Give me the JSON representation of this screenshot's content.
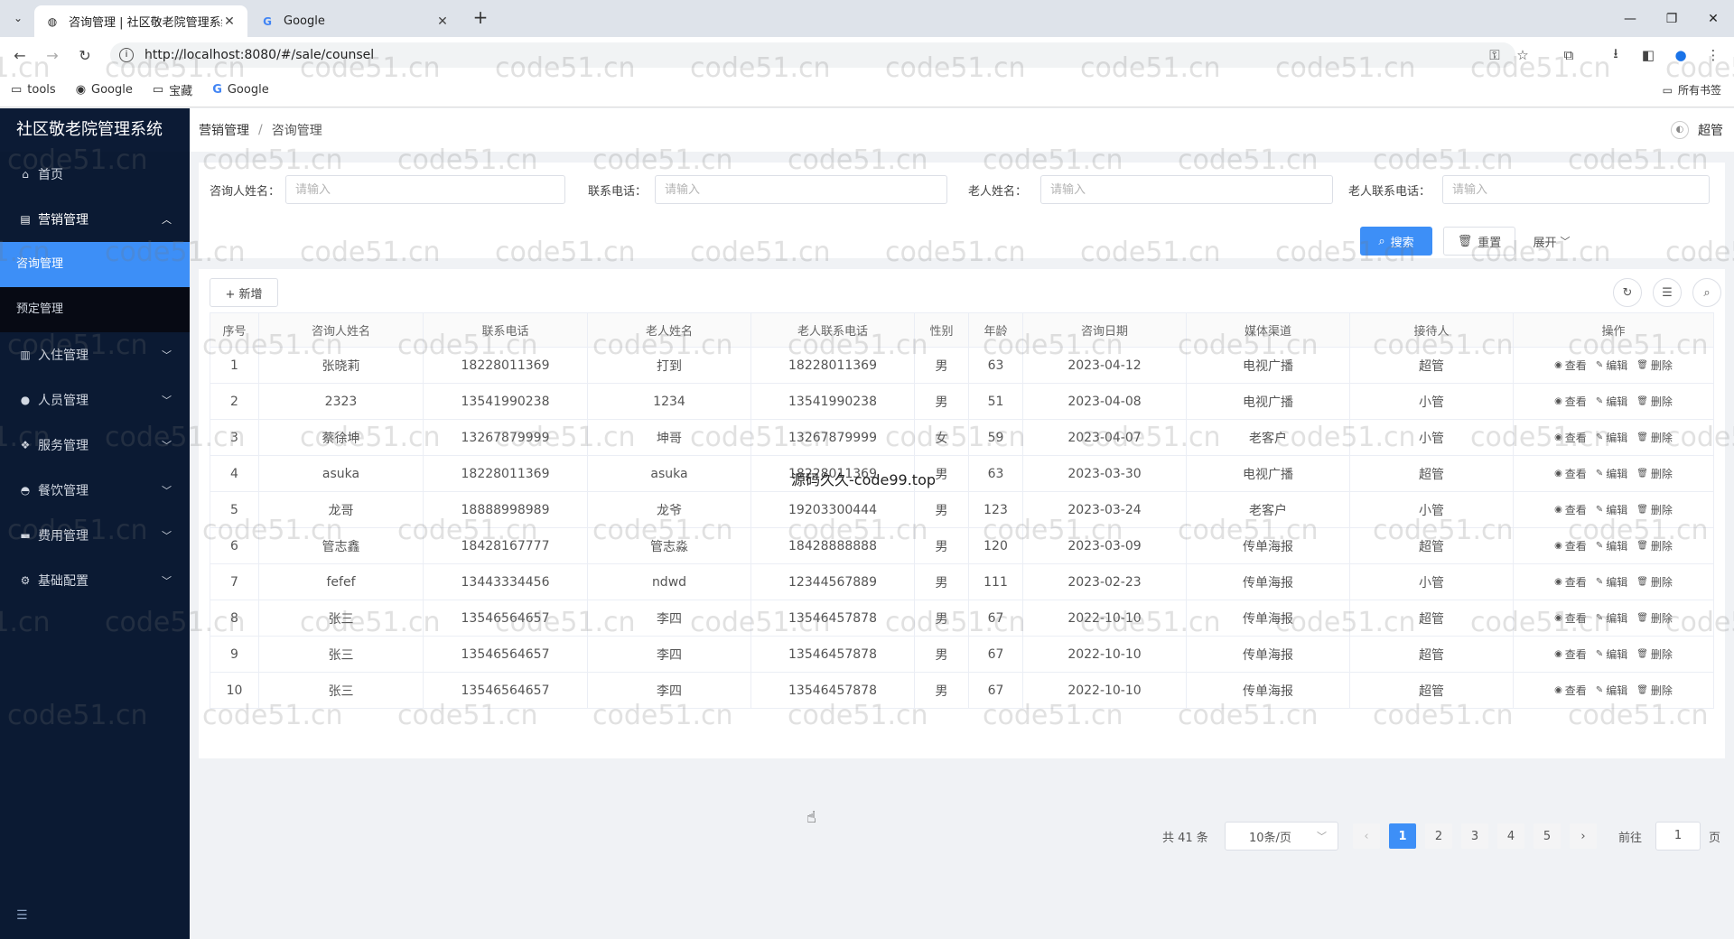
{
  "browser": {
    "tabs": [
      {
        "title": "咨询管理 | 社区敬老院管理系统",
        "active": true
      },
      {
        "title": "Google",
        "active": false
      }
    ],
    "url": "http://localhost:8080/#/sale/counsel",
    "bookmarks": [
      {
        "label": "tools",
        "icon": "folder-icon"
      },
      {
        "label": "Google",
        "icon": "globe-icon"
      },
      {
        "label": "宝藏",
        "icon": "folder-icon"
      },
      {
        "label": "Google",
        "icon": "google-icon"
      }
    ],
    "all_bookmarks_label": "所有书签"
  },
  "sidebar": {
    "title": "社区敬老院管理系统",
    "items": [
      {
        "label": "首页",
        "icon": "home-icon"
      },
      {
        "label": "营销管理",
        "icon": "chart-icon",
        "open": true,
        "children": [
          {
            "label": "咨询管理",
            "active": true
          },
          {
            "label": "预定管理"
          }
        ]
      },
      {
        "label": "入住管理",
        "icon": "checkin-icon"
      },
      {
        "label": "人员管理",
        "icon": "user-icon"
      },
      {
        "label": "服务管理",
        "icon": "service-icon"
      },
      {
        "label": "餐饮管理",
        "icon": "food-icon"
      },
      {
        "label": "费用管理",
        "icon": "card-icon"
      },
      {
        "label": "基础配置",
        "icon": "gear-icon"
      }
    ]
  },
  "header": {
    "breadcrumb": [
      "营销管理",
      "咨询管理"
    ],
    "username": "超管"
  },
  "search": {
    "fields": [
      {
        "label": "咨询人姓名：",
        "placeholder": "请输入"
      },
      {
        "label": "联系电话：",
        "placeholder": "请输入"
      },
      {
        "label": "老人姓名：",
        "placeholder": "请输入"
      },
      {
        "label": "老人联系电话：",
        "placeholder": "请输入"
      }
    ],
    "search_label": "搜索",
    "reset_label": "重置",
    "expand_label": "展开"
  },
  "toolbar": {
    "add_label": "+ 新增"
  },
  "table": {
    "columns": [
      "序号",
      "咨询人姓名",
      "联系电话",
      "老人姓名",
      "老人联系电话",
      "性别",
      "年龄",
      "咨询日期",
      "媒体渠道",
      "接待人",
      "操作"
    ],
    "actions": [
      "查看",
      "编辑",
      "删除"
    ],
    "rows": [
      [
        "1",
        "张晓莉",
        "18228011369",
        "打到",
        "18228011369",
        "男",
        "63",
        "2023-04-12",
        "电视广播",
        "超管"
      ],
      [
        "2",
        "2323",
        "13541990238",
        "1234",
        "13541990238",
        "男",
        "51",
        "2023-04-08",
        "电视广播",
        "小管"
      ],
      [
        "3",
        "蔡徐坤",
        "13267879999",
        "坤哥",
        "13267879999",
        "女",
        "59",
        "2023-04-07",
        "老客户",
        "小管"
      ],
      [
        "4",
        "asuka",
        "18228011369",
        "asuka",
        "18228011369",
        "男",
        "63",
        "2023-03-30",
        "电视广播",
        "超管"
      ],
      [
        "5",
        "龙哥",
        "18888998989",
        "龙爷",
        "19203300444",
        "男",
        "123",
        "2023-03-24",
        "老客户",
        "小管"
      ],
      [
        "6",
        "管志鑫",
        "18428167777",
        "管志淼",
        "18428888888",
        "男",
        "120",
        "2023-03-09",
        "传单海报",
        "超管"
      ],
      [
        "7",
        "fefef",
        "13443334456",
        "ndwd",
        "12344567889",
        "男",
        "111",
        "2023-02-23",
        "传单海报",
        "小管"
      ],
      [
        "8",
        "张三",
        "13546564657",
        "李四",
        "13546457878",
        "男",
        "67",
        "2022-10-10",
        "传单海报",
        "超管"
      ],
      [
        "9",
        "张三",
        "13546564657",
        "李四",
        "13546457878",
        "男",
        "67",
        "2022-10-10",
        "传单海报",
        "超管"
      ],
      [
        "10",
        "张三",
        "13546564657",
        "李四",
        "13546457878",
        "男",
        "67",
        "2022-10-10",
        "传单海报",
        "超管"
      ]
    ]
  },
  "pagination": {
    "total_label": "共 41 条",
    "page_size_label": "10条/页",
    "pages": [
      "1",
      "2",
      "3",
      "4",
      "5"
    ],
    "current_page": "1",
    "goto_label": "前往",
    "goto_value": "1",
    "page_suffix": "页"
  },
  "overlay_text": "源码久久-code99.top",
  "watermark": "code51.cn",
  "colors": {
    "accent": "#3d8ff7",
    "sidebar_bg": "#0b1a33"
  }
}
